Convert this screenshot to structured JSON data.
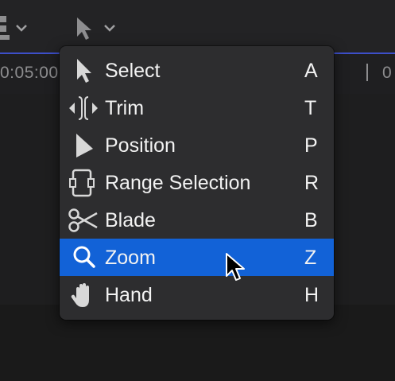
{
  "ruler": {
    "timecode": "0:05:00",
    "timecode_right": "0"
  },
  "menu": {
    "items": [
      {
        "label": "Select",
        "shortcut": "A",
        "icon": "arrow-pointer-icon"
      },
      {
        "label": "Trim",
        "shortcut": "T",
        "icon": "trim-icon"
      },
      {
        "label": "Position",
        "shortcut": "P",
        "icon": "position-arrow-icon"
      },
      {
        "label": "Range Selection",
        "shortcut": "R",
        "icon": "range-selection-icon"
      },
      {
        "label": "Blade",
        "shortcut": "B",
        "icon": "scissors-icon"
      },
      {
        "label": "Zoom",
        "shortcut": "Z",
        "icon": "magnifier-icon",
        "selected": true
      },
      {
        "label": "Hand",
        "shortcut": "H",
        "icon": "hand-icon"
      }
    ]
  },
  "colors": {
    "menu_bg": "#2d2d2f",
    "highlight": "#1262d7",
    "timeline_accent": "#3d4fc9"
  }
}
